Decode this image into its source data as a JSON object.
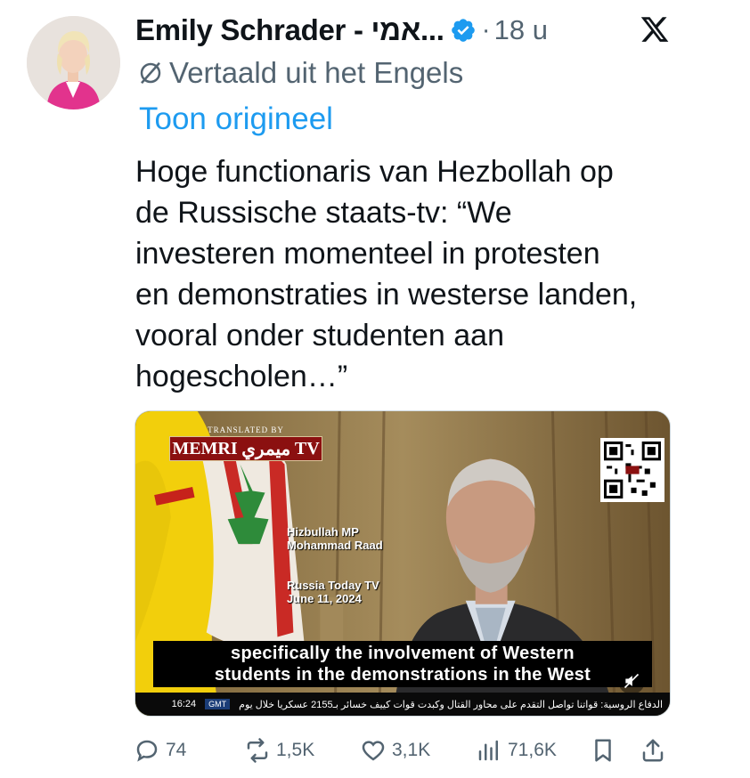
{
  "author": {
    "name": "Emily Schrader - אמי...",
    "time": "18 u"
  },
  "translation": {
    "label": "Vertaald uit het Engels",
    "show_original": "Toon origineel"
  },
  "tweet": {
    "text": "Hoge functionaris van Hezbollah op\nde Russische staats-tv: “We\ninvesteren momenteel in protesten\nen demonstraties in westerse landen,\nvooral onder studenten aan\nhogescholen…”"
  },
  "media": {
    "translated_by": "TRANSLATED BY",
    "memri_left": "MEMRI",
    "memri_arabic": "ميمري",
    "memri_right": "TV",
    "speaker_line1": "Hizbullah MP",
    "speaker_line2": "Mohammad Raad",
    "source_line1": "Russia Today TV",
    "source_line2": "June 11, 2024",
    "subtitle_line1": "specifically the involvement of Western",
    "subtitle_line2": "students in the demonstrations in the West",
    "ticker_text": "الدفاع الروسية: قواتنا تواصل التقدم على محاور القتال وكبدت قوات كييف خسائر بـ2155 عسكريا خلال يوم",
    "ticker_time": "16:24",
    "ticker_zone": "GMT"
  },
  "actions": {
    "replies": "74",
    "reposts": "1,5K",
    "likes": "3,1K",
    "views": "71,6K"
  },
  "colors": {
    "link": "#1d9bf0",
    "verified": "#1d9bf0",
    "secondary": "#536471"
  }
}
